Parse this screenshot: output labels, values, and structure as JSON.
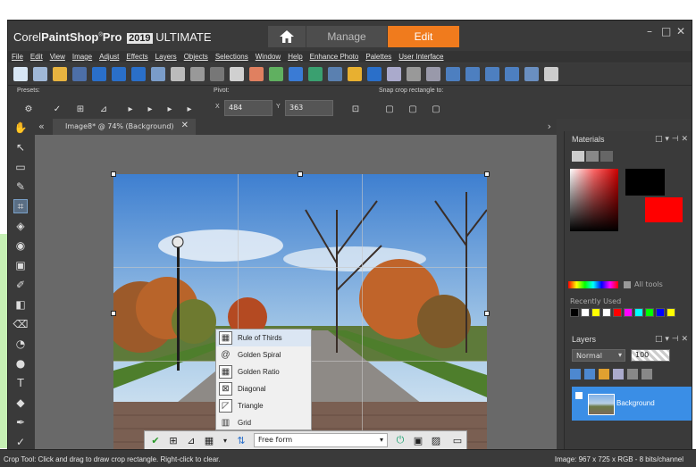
{
  "app": {
    "brand_prefix": "Corel",
    "brand_name": "PaintShop",
    "brand_suffix": "Pro",
    "year": "2019",
    "edition": "ULTIMATE",
    "tabs": {
      "manage": "Manage",
      "edit": "Edit"
    },
    "window_controls": {
      "minimize": "–",
      "maximize": "□",
      "close": "✕"
    }
  },
  "menu": [
    "File",
    "Edit",
    "View",
    "Image",
    "Adjust",
    "Effects",
    "Layers",
    "Objects",
    "Selections",
    "Window",
    "Help",
    "Enhance Photo",
    "Palettes",
    "User Interface"
  ],
  "options": {
    "presets_label": "Presets:",
    "pivot_label": "Pivot:",
    "x_label": "X",
    "x_value": "484",
    "y_label": "Y",
    "y_value": "363",
    "snap_label": "Snap crop rectangle to:"
  },
  "document": {
    "tab_label": "Image8* @  74% (Background)",
    "tab_close": "✕",
    "collapse_arrow": "«",
    "expand_arrow": "›"
  },
  "popup": {
    "items": [
      "Rule of Thirds",
      "Golden Spiral",
      "Golden Ratio",
      "Diagonal",
      "Triangle",
      "Grid"
    ],
    "icons": [
      "rule-of-thirds-icon",
      "golden-spiral-icon",
      "golden-ratio-icon",
      "diagonal-icon",
      "triangle-icon",
      "grid-icon"
    ]
  },
  "crop_toolbar": {
    "aspect_value": "Free form"
  },
  "materials": {
    "title": "Materials",
    "all_tools_label": "All tools",
    "recently_used_label": "Recently Used",
    "foreground_color": "#000000",
    "background_color": "#ff0000",
    "recent_colors": [
      "#000000",
      "#ffffff",
      "#ffff00",
      "#ffffff",
      "#ff0000",
      "#ff00ff",
      "#00ffff",
      "#00ff00",
      "#0000ff",
      "#ffff00"
    ]
  },
  "layers": {
    "title": "Layers",
    "blend_mode": "Normal",
    "opacity": "100",
    "layer_name": "Background"
  },
  "status": {
    "left": "Crop Tool: Click and drag to draw crop rectangle. Right-click to clear.",
    "right": "Image:  967 x 725 x RGB - 8 bits/channel"
  },
  "colors": {
    "accent_edit_tab": "#f07b1d",
    "selected_layer": "#3a8ee6"
  }
}
